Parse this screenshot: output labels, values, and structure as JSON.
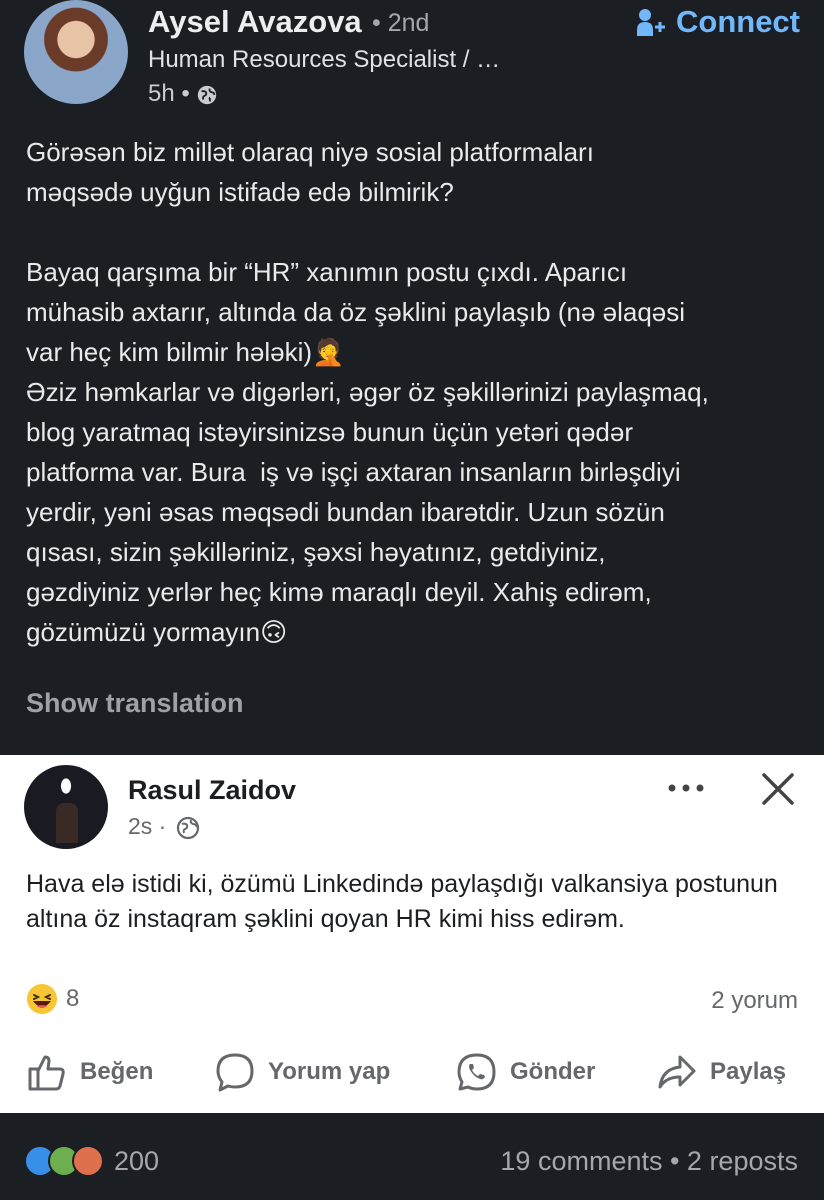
{
  "post": {
    "author": "Aysel Avazova",
    "degree": "• 2nd",
    "headline": "Human Resources Specialist / …",
    "time": "5h •",
    "connect_label": "Connect",
    "body": "Görəsən biz millət olaraq niyə sosial platformaları\nməqsədə uyğun istifadə edə bilmirik?\n\nBayaq qarşıma bir “HR” xanımın postu çıxdı. Aparıcı\nmühasib axtarır, altında da öz şəklini paylaşıb (nə əlaqəsi\nvar heç kim bilmir hələki)🤦\nƏziz həmkarlar və digərləri, əgər öz şəkillərinizi paylaşmaq,\nblog yaratmaq istəyirsinizsə bunun üçün yetəri qədər\nplatforma var. Bura  iş və işçi axtaran insanların birləşdiyi\nyerdir, yəni əsas məqsədi bundan ibarətdir. Uzun sözün\nqısası, sizin şəkilləriniz, şəxsi həyatınız, getdiyiniz,\ngəzdiyiniz yerlər heç kimə maraqlı deyil. Xahiş edirəm,\ngözümüzü yormayın🙃",
    "show_translation": "Show translation"
  },
  "embed": {
    "author": "Rasul Zaidov",
    "time": "2s ·",
    "text": "Hava elə istidi ki, özümü Linkedində paylaşdığı valkansiya postunun altına öz instaqram şəklini qoyan HR kimi hiss edirəm.",
    "reaction_count": "8",
    "comments": "2 yorum",
    "actions": {
      "like": "Beğen",
      "comment": "Yorum yap",
      "send": "Gönder",
      "share": "Paylaş"
    }
  },
  "stats": {
    "reactions": "200",
    "comments_reposts": "19 comments • 2 reposts"
  },
  "colors": {
    "background": "#1b1f23",
    "accent": "#71b7fb",
    "card": "#ffffff"
  },
  "icons": [
    "globe-icon",
    "add-person-icon",
    "more-icon",
    "close-icon",
    "thumbs-up-icon",
    "comment-icon",
    "whatsapp-icon",
    "share-icon",
    "laughing-emoji-icon"
  ]
}
